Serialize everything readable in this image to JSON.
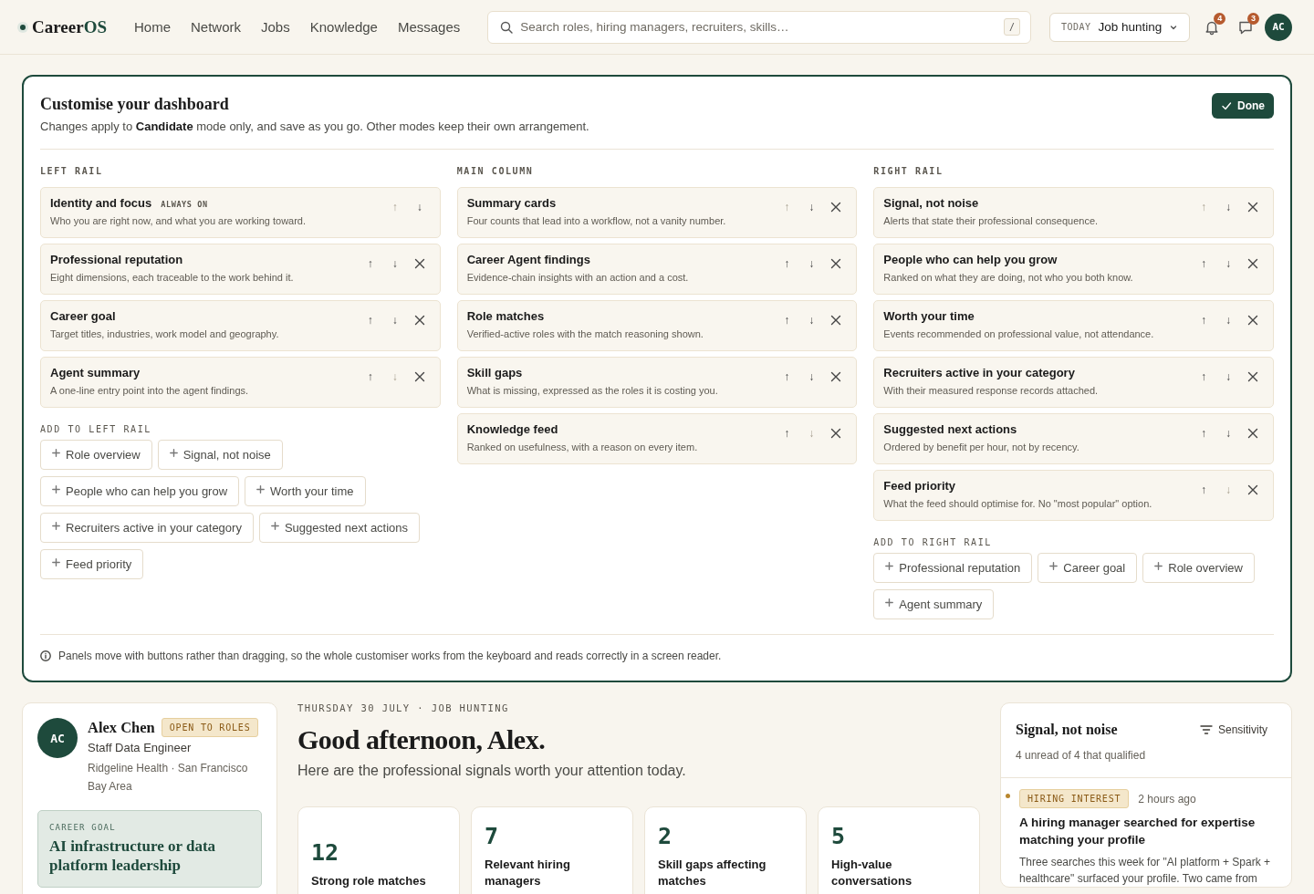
{
  "nav": {
    "logo": {
      "main": "Career",
      "accent": "OS"
    },
    "links": [
      {
        "label": "Home"
      },
      {
        "label": "Network"
      },
      {
        "label": "Jobs"
      },
      {
        "label": "Knowledge"
      },
      {
        "label": "Messages"
      }
    ],
    "search": {
      "placeholder": "Search roles, hiring managers, recruiters, skills…",
      "shortcut": "/"
    },
    "mode": {
      "label": "TODAY",
      "value": "Job hunting"
    },
    "notifications": {
      "count": "4"
    },
    "messages": {
      "count": "3"
    },
    "avatar": "AC"
  },
  "customiser": {
    "move_up": "↑",
    "move_down": "↓",
    "title": "Customise your dashboard",
    "subtitle": "Changes apply to **Candidate** mode only, and save as you go. Other modes keep their own arrangement.",
    "done_button": "Done",
    "columns": [
      {
        "heading": "LEFT RAIL",
        "panels": [
          {
            "title": "Identity and focus",
            "badge": "ALWAYS ON",
            "description": "Who you are right now, and what you are working toward.",
            "up_disabled": true,
            "down_disabled": false,
            "removable": false
          },
          {
            "title": "Professional reputation",
            "description": "Eight dimensions, each traceable to the work behind it.",
            "up_disabled": false,
            "down_disabled": false,
            "removable": true
          },
          {
            "title": "Career goal",
            "description": "Target titles, industries, work model and geography.",
            "up_disabled": false,
            "down_disabled": false,
            "removable": true
          },
          {
            "title": "Agent summary",
            "description": "A one-line entry point into the agent findings.",
            "up_disabled": false,
            "down_disabled": true,
            "removable": true
          }
        ],
        "add_heading": "ADD TO LEFT RAIL",
        "add_options": [
          "Role overview",
          "Signal, not noise",
          "People who can help you grow",
          "Worth your time",
          "Recruiters active in your category",
          "Suggested next actions",
          "Feed priority"
        ]
      },
      {
        "heading": "MAIN COLUMN",
        "panels": [
          {
            "title": "Summary cards",
            "description": "Four counts that lead into a workflow, not a vanity number.",
            "up_disabled": true,
            "down_disabled": false,
            "removable": true
          },
          {
            "title": "Career Agent findings",
            "description": "Evidence-chain insights with an action and a cost.",
            "up_disabled": false,
            "down_disabled": false,
            "removable": true
          },
          {
            "title": "Role matches",
            "description": "Verified-active roles with the match reasoning shown.",
            "up_disabled": false,
            "down_disabled": false,
            "removable": true
          },
          {
            "title": "Skill gaps",
            "description": "What is missing, expressed as the roles it is costing you.",
            "up_disabled": false,
            "down_disabled": false,
            "removable": true
          },
          {
            "title": "Knowledge feed",
            "description": "Ranked on usefulness, with a reason on every item.",
            "up_disabled": false,
            "down_disabled": true,
            "removable": true
          }
        ]
      },
      {
        "heading": "RIGHT RAIL",
        "panels": [
          {
            "title": "Signal, not noise",
            "description": "Alerts that state their professional consequence.",
            "up_disabled": true,
            "down_disabled": false,
            "removable": true
          },
          {
            "title": "People who can help you grow",
            "description": "Ranked on what they are doing, not who you both know.",
            "up_disabled": false,
            "down_disabled": false,
            "removable": true
          },
          {
            "title": "Worth your time",
            "description": "Events recommended on professional value, not attendance.",
            "up_disabled": false,
            "down_disabled": false,
            "removable": true
          },
          {
            "title": "Recruiters active in your category",
            "description": "With their measured response records attached.",
            "up_disabled": false,
            "down_disabled": false,
            "removable": true
          },
          {
            "title": "Suggested next actions",
            "description": "Ordered by benefit per hour, not by recency.",
            "up_disabled": false,
            "down_disabled": false,
            "removable": true
          },
          {
            "title": "Feed priority",
            "description": "What the feed should optimise for. No \"most popular\" option.",
            "up_disabled": false,
            "down_disabled": true,
            "removable": true
          }
        ],
        "add_heading": "ADD TO RIGHT RAIL",
        "add_options": [
          "Professional reputation",
          "Career goal",
          "Role overview",
          "Agent summary"
        ]
      }
    ],
    "note": "Panels move with buttons rather than dragging, so the whole customiser works from the keyboard and reads correctly in a screen reader."
  },
  "profile": {
    "avatar": "AC",
    "name": "Alex Chen",
    "badge": "OPEN TO ROLES",
    "title": "Staff Data Engineer",
    "location": "Ridgeline Health · San Francisco Bay Area",
    "career_goal": {
      "label": "CAREER GOAL",
      "goal": "AI infrastructure or data platform leadership"
    }
  },
  "greeting": {
    "date": "THURSDAY 30 JULY · JOB HUNTING",
    "title": "Good afternoon, Alex.",
    "subtitle": "Here are the professional signals worth your attention today."
  },
  "stats": [
    {
      "value": "12",
      "label": "Strong role matches"
    },
    {
      "value": "7",
      "label": "Relevant hiring managers"
    },
    {
      "value": "2",
      "label": "Skill gaps affecting matches"
    },
    {
      "value": "5",
      "label": "High-value conversations"
    }
  ],
  "signals": {
    "title": "Signal, not noise",
    "filter_button": "Sensitivity",
    "summary": "4 unread of 4 that qualified",
    "items": [
      {
        "unread": true,
        "color": "#b8862e",
        "tag": "HIRING INTEREST",
        "time": "2 hours ago",
        "title": "A hiring manager searched for expertise matching your profile",
        "body": "Three searches this week for \"AI platform + Spark + healthcare\" surfaced your profile. Two came from"
      }
    ]
  }
}
